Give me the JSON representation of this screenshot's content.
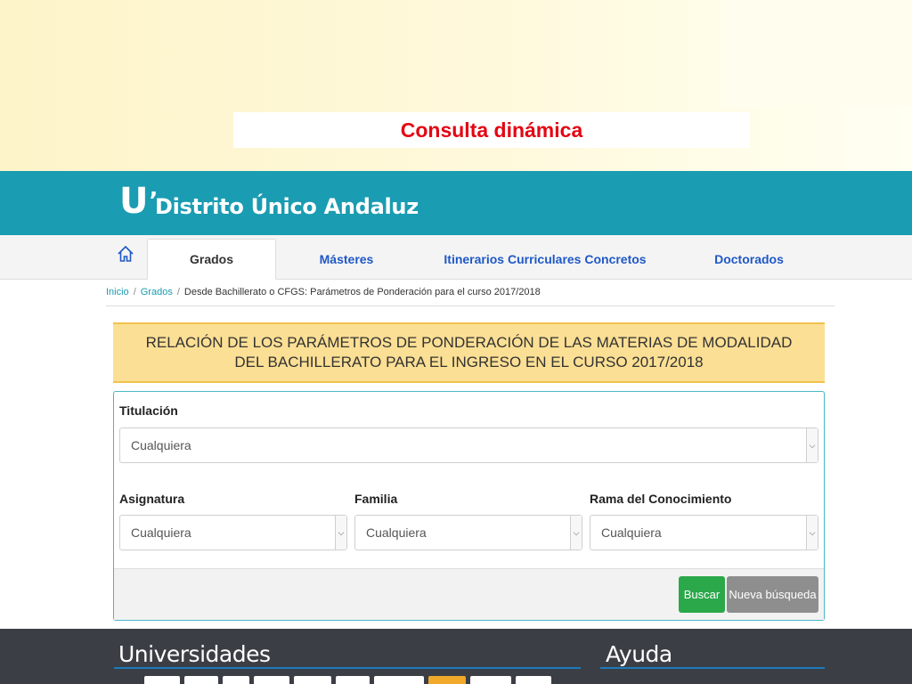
{
  "slide": {
    "title": "Consulta dinámica"
  },
  "brand": {
    "logo_mark": "U",
    "logo_tick": "’",
    "name": "Distrito Único Andaluz"
  },
  "nav": {
    "home_icon": "home-icon",
    "tabs": [
      {
        "label": "Grados",
        "active": true
      },
      {
        "label": "Másteres",
        "active": false
      },
      {
        "label": "Itinerarios Curriculares Concretos",
        "active": false
      },
      {
        "label": "Doctorados",
        "active": false
      }
    ]
  },
  "breadcrumb": {
    "items": [
      "Inicio",
      "Grados"
    ],
    "current": "Desde Bachillerato o CFGS: Parámetros de Ponderación para el curso 2017/2018"
  },
  "heading": {
    "text": "RELACIÓN DE LOS PARÁMETROS DE PONDERACIÓN DE LAS MATERIAS DE MODALIDAD DEL BACHILLERATO PARA EL INGRESO EN EL CURSO 2017/2018"
  },
  "form": {
    "titulacion": {
      "label": "Titulación",
      "value": "Cualquiera"
    },
    "asignatura": {
      "label": "Asignatura",
      "value": "Cualquiera"
    },
    "familia": {
      "label": "Familia",
      "value": "Cualquiera"
    },
    "rama": {
      "label": "Rama del Conocimiento",
      "value": "Cualquiera"
    },
    "search_button": "Buscar",
    "new_search_button": "Nueva búsqueda"
  },
  "footer": {
    "universidades_title": "Universidades",
    "ayuda_title": "Ayuda"
  },
  "colors": {
    "brand_teal": "#1a9cb2",
    "accent_red": "#e30613",
    "heading_yellow": "#fbdf94",
    "button_green": "#2ba84a",
    "button_gray": "#8e8e8e",
    "footer_dark": "#3b3f45"
  }
}
